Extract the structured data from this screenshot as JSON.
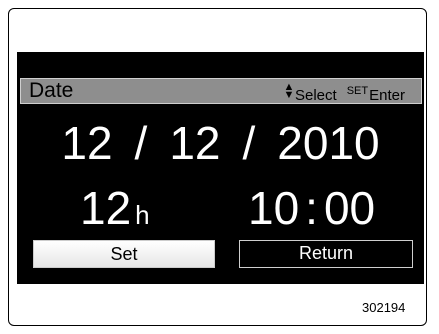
{
  "screen": {
    "header": {
      "title": "Date",
      "select_label": "Select",
      "set_key": "SET",
      "enter_label": "Enter",
      "up_glyph": "▲",
      "down_glyph": "▼"
    },
    "date": {
      "month": "12",
      "day": "12",
      "year": "2010",
      "separator": "/"
    },
    "clock": {
      "format_value": "12",
      "format_unit": "h",
      "hours": "10",
      "colon": ":",
      "minutes": "00"
    },
    "buttons": {
      "set_label": "Set",
      "return_label": "Return"
    },
    "colors": {
      "screen_bg": "#000000",
      "header_bg": "#8e8e8e",
      "text": "#ffffff",
      "selected_button_bg": "#ffffff"
    }
  },
  "figure_number": "302194"
}
